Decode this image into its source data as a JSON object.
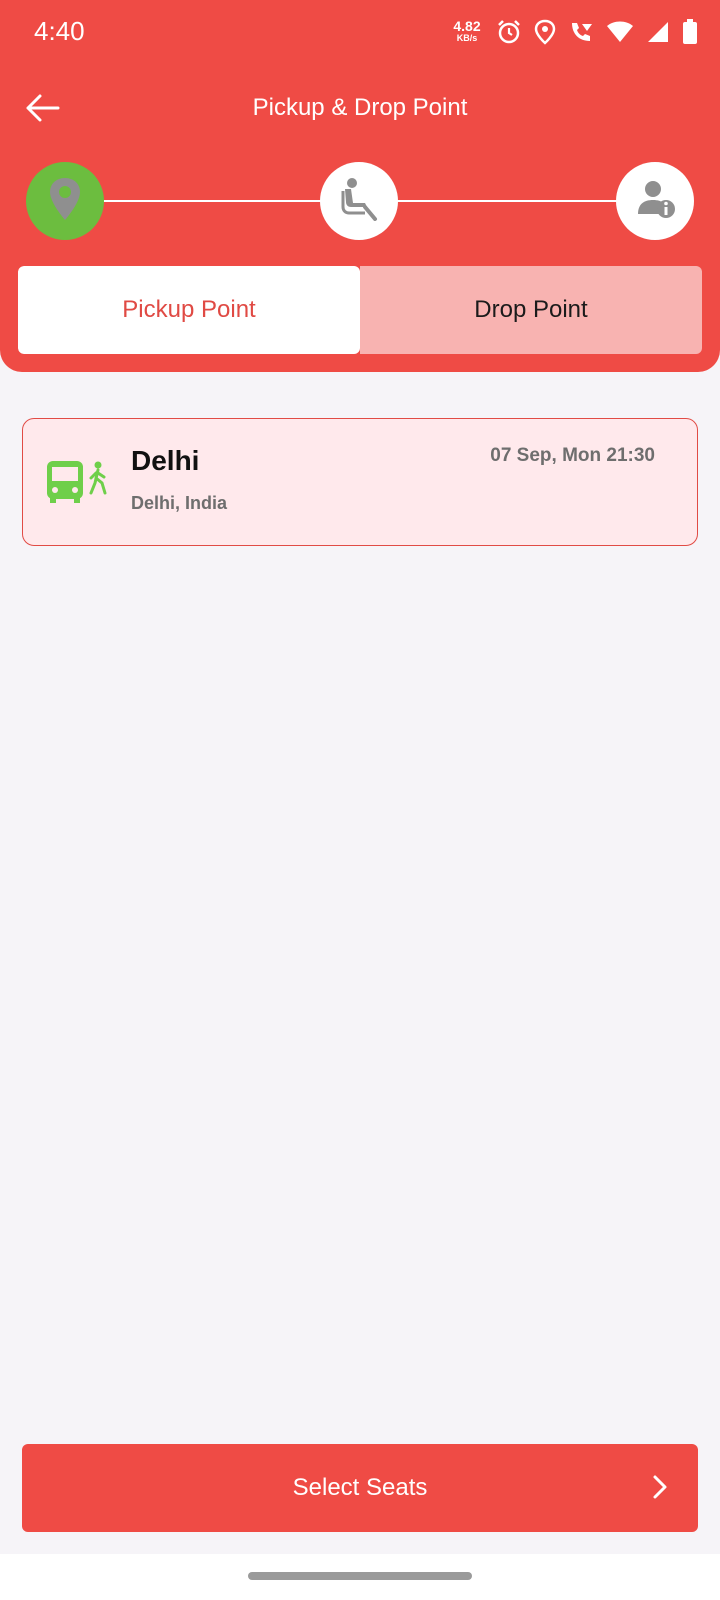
{
  "status_bar": {
    "time": "4:40",
    "net_speed_value": "4.82",
    "net_speed_unit": "KB/s",
    "icons": [
      "alarm-icon",
      "location-icon",
      "wifi-calling-icon",
      "wifi-icon",
      "signal-icon",
      "battery-icon"
    ]
  },
  "header": {
    "title": "Pickup & Drop Point",
    "back_icon": "arrow-left-icon"
  },
  "stepper": {
    "steps": [
      {
        "icon": "location-pin-icon",
        "state": "active"
      },
      {
        "icon": "seat-icon",
        "state": "pending"
      },
      {
        "icon": "passenger-info-icon",
        "state": "pending"
      }
    ]
  },
  "tabs": {
    "pickup_label": "Pickup Point",
    "drop_label": "Drop Point",
    "active": "pickup"
  },
  "points": [
    {
      "name": "Delhi",
      "address": "Delhi, India",
      "time": "07 Sep, Mon 21:30",
      "icon": "bus-walk-icon",
      "selected": true
    }
  ],
  "footer": {
    "select_seats_label": "Select Seats",
    "chevron_icon": "chevron-right-icon"
  },
  "colors": {
    "primary": "#ef4b45",
    "step_active": "#6cbd3f",
    "card_background": "#ffe9ec",
    "tab_inactive": "#f8b3b1",
    "page_background": "#f6f4f8"
  }
}
